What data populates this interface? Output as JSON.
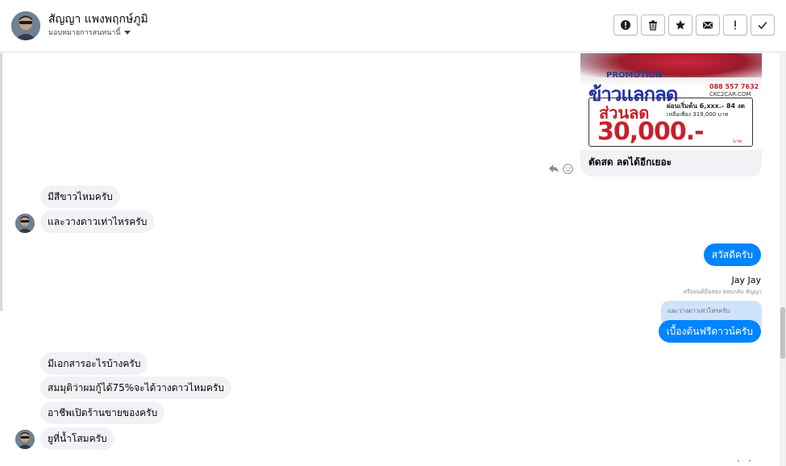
{
  "header": {
    "contact_name": "สัญญา แพงพฤกษ์ภูมิ",
    "assign_label": "มอบหมายการสนทนานี้",
    "toolbar": [
      {
        "name": "alert-button",
        "icon": "alert-circle-icon"
      },
      {
        "name": "delete-button",
        "icon": "trash-icon"
      },
      {
        "name": "star-button",
        "icon": "star-icon"
      },
      {
        "name": "mark-unread-button",
        "icon": "envelope-icon"
      },
      {
        "name": "spam-button",
        "icon": "exclamation-icon"
      },
      {
        "name": "done-button",
        "icon": "check-icon"
      }
    ]
  },
  "promo": {
    "label": "PROMOTION",
    "title": "ข้าวแลกลด",
    "phone": "088 557 7632",
    "website": "CKC2CAR.COM",
    "discount_text": "ส่วนลด",
    "installment": "ผ่อนเริ่มต้น 6,xxx.- 84 งด",
    "remaining": "เหลือเพียง 319,000 บาท",
    "amount": "30,000.-",
    "unit": "บาท",
    "caption": "ตัดสด ลดได้อีกเยอะ"
  },
  "messages_in_1": [
    "มีสีขาวไหมครับ",
    "และวางดาวเท่าไหรครับ"
  ],
  "message_out_1": "สวัสดีครับ",
  "reply": {
    "sender": "Jay Jay",
    "note": "ศรีอยนต์มือสอง ตอบกลับ สัญญา",
    "quoted_text": "และวางดาวเท่าไหรครับ",
    "text": "เบื้องต้นฟรีดาวน์ครับ"
  },
  "messages_in_2": [
    "มีเอกสารอะไรบ้างครับ",
    "สมมุติว่าผมกู้ได้75%จะได้วางดาวไหมครับ",
    "อาชีพเปิดร้านขายของครับ",
    "ยูที่น้ำโสมครับ"
  ],
  "colors": {
    "outgoing_bubble": "#0084ff",
    "incoming_bubble": "#f0f2f5",
    "quoted_bubble": "#cfe3fb"
  }
}
